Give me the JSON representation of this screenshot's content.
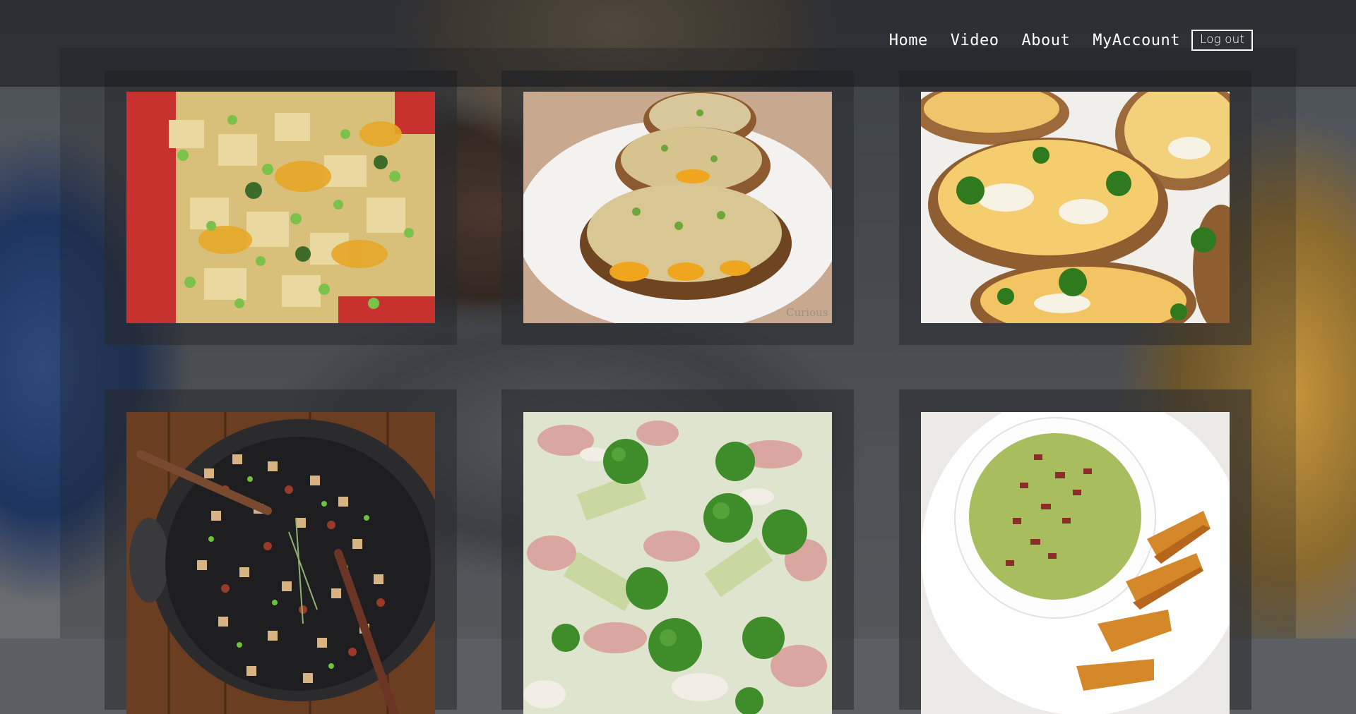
{
  "nav": {
    "items": [
      {
        "label": "Home"
      },
      {
        "label": "Video"
      },
      {
        "label": "About"
      },
      {
        "label": "MyAccount"
      }
    ],
    "logout_label": "Log out"
  },
  "gallery": {
    "items": [
      {
        "name": "loaded-potato-casserole-photo",
        "watermark": ""
      },
      {
        "name": "twice-baked-potatoes-photo",
        "watermark": "Curious"
      },
      {
        "name": "broccoli-cheddar-potato-skins-photo",
        "watermark": ""
      },
      {
        "name": "potato-bacon-hash-skillet-photo",
        "watermark": ""
      },
      {
        "name": "broccoli-bacon-salad-photo",
        "watermark": ""
      },
      {
        "name": "broccoli-soup-with-wedges-photo",
        "watermark": ""
      }
    ]
  },
  "colors": {
    "nav_text": "#ffffff",
    "topbar": "rgba(20,22,26,0.55)"
  }
}
